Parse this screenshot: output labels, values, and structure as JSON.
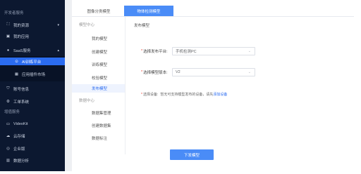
{
  "sidebar": {
    "group1": "开发者服务",
    "items": [
      {
        "label": "我的资源",
        "icon": "resource-icon",
        "chev": "▾"
      },
      {
        "label": "我的应用",
        "icon": "app-icon",
        "chev": ""
      },
      {
        "label": "SaaS服务",
        "icon": "cloud-service-icon",
        "chev": "▴"
      },
      {
        "label": "AI训练平台",
        "icon": "ai-platform-icon",
        "chev": ""
      },
      {
        "label": "应用插件市场",
        "icon": "plugin-market-icon",
        "chev": ""
      },
      {
        "label": "账号信息",
        "icon": "account-icon",
        "chev": ""
      },
      {
        "label": "工单系统",
        "icon": "ticket-icon",
        "chev": ""
      }
    ],
    "group2": "增值服务",
    "items2": [
      {
        "label": "VideoKit",
        "icon": "video-icon"
      },
      {
        "label": "云存储",
        "icon": "cloud-storage-icon"
      },
      {
        "label": "企业版",
        "icon": "enterprise-icon"
      },
      {
        "label": "数据分析",
        "icon": "analytics-icon"
      }
    ]
  },
  "tabs": [
    {
      "label": "图像分类模型",
      "active": false
    },
    {
      "label": "物体检测模型",
      "active": true
    }
  ],
  "submenu": {
    "header1": "模型中心",
    "items1": [
      "我的模型",
      "创建模型",
      "训练模型",
      "校验模型",
      "发布模型"
    ],
    "active": "发布模型",
    "header2": "数据中心",
    "items2": [
      "数据集管理",
      "创建数据集",
      "数据标注"
    ]
  },
  "form": {
    "section_title": "发布模型",
    "platform_label": "选择发布平台:",
    "platform_value": "手机检测PC",
    "version_label": "选择模型版本:",
    "version_value": "V2",
    "device_label": "选择设备:",
    "device_tip_text": "暂无可支持模型发布的设备，请先",
    "device_tip_link": "添加设备",
    "submit_label": "下发模型"
  },
  "colors": {
    "sidebar_bg": "#0c1830",
    "accent": "#2b6cf0",
    "tab_active": "#4a8cf7"
  }
}
